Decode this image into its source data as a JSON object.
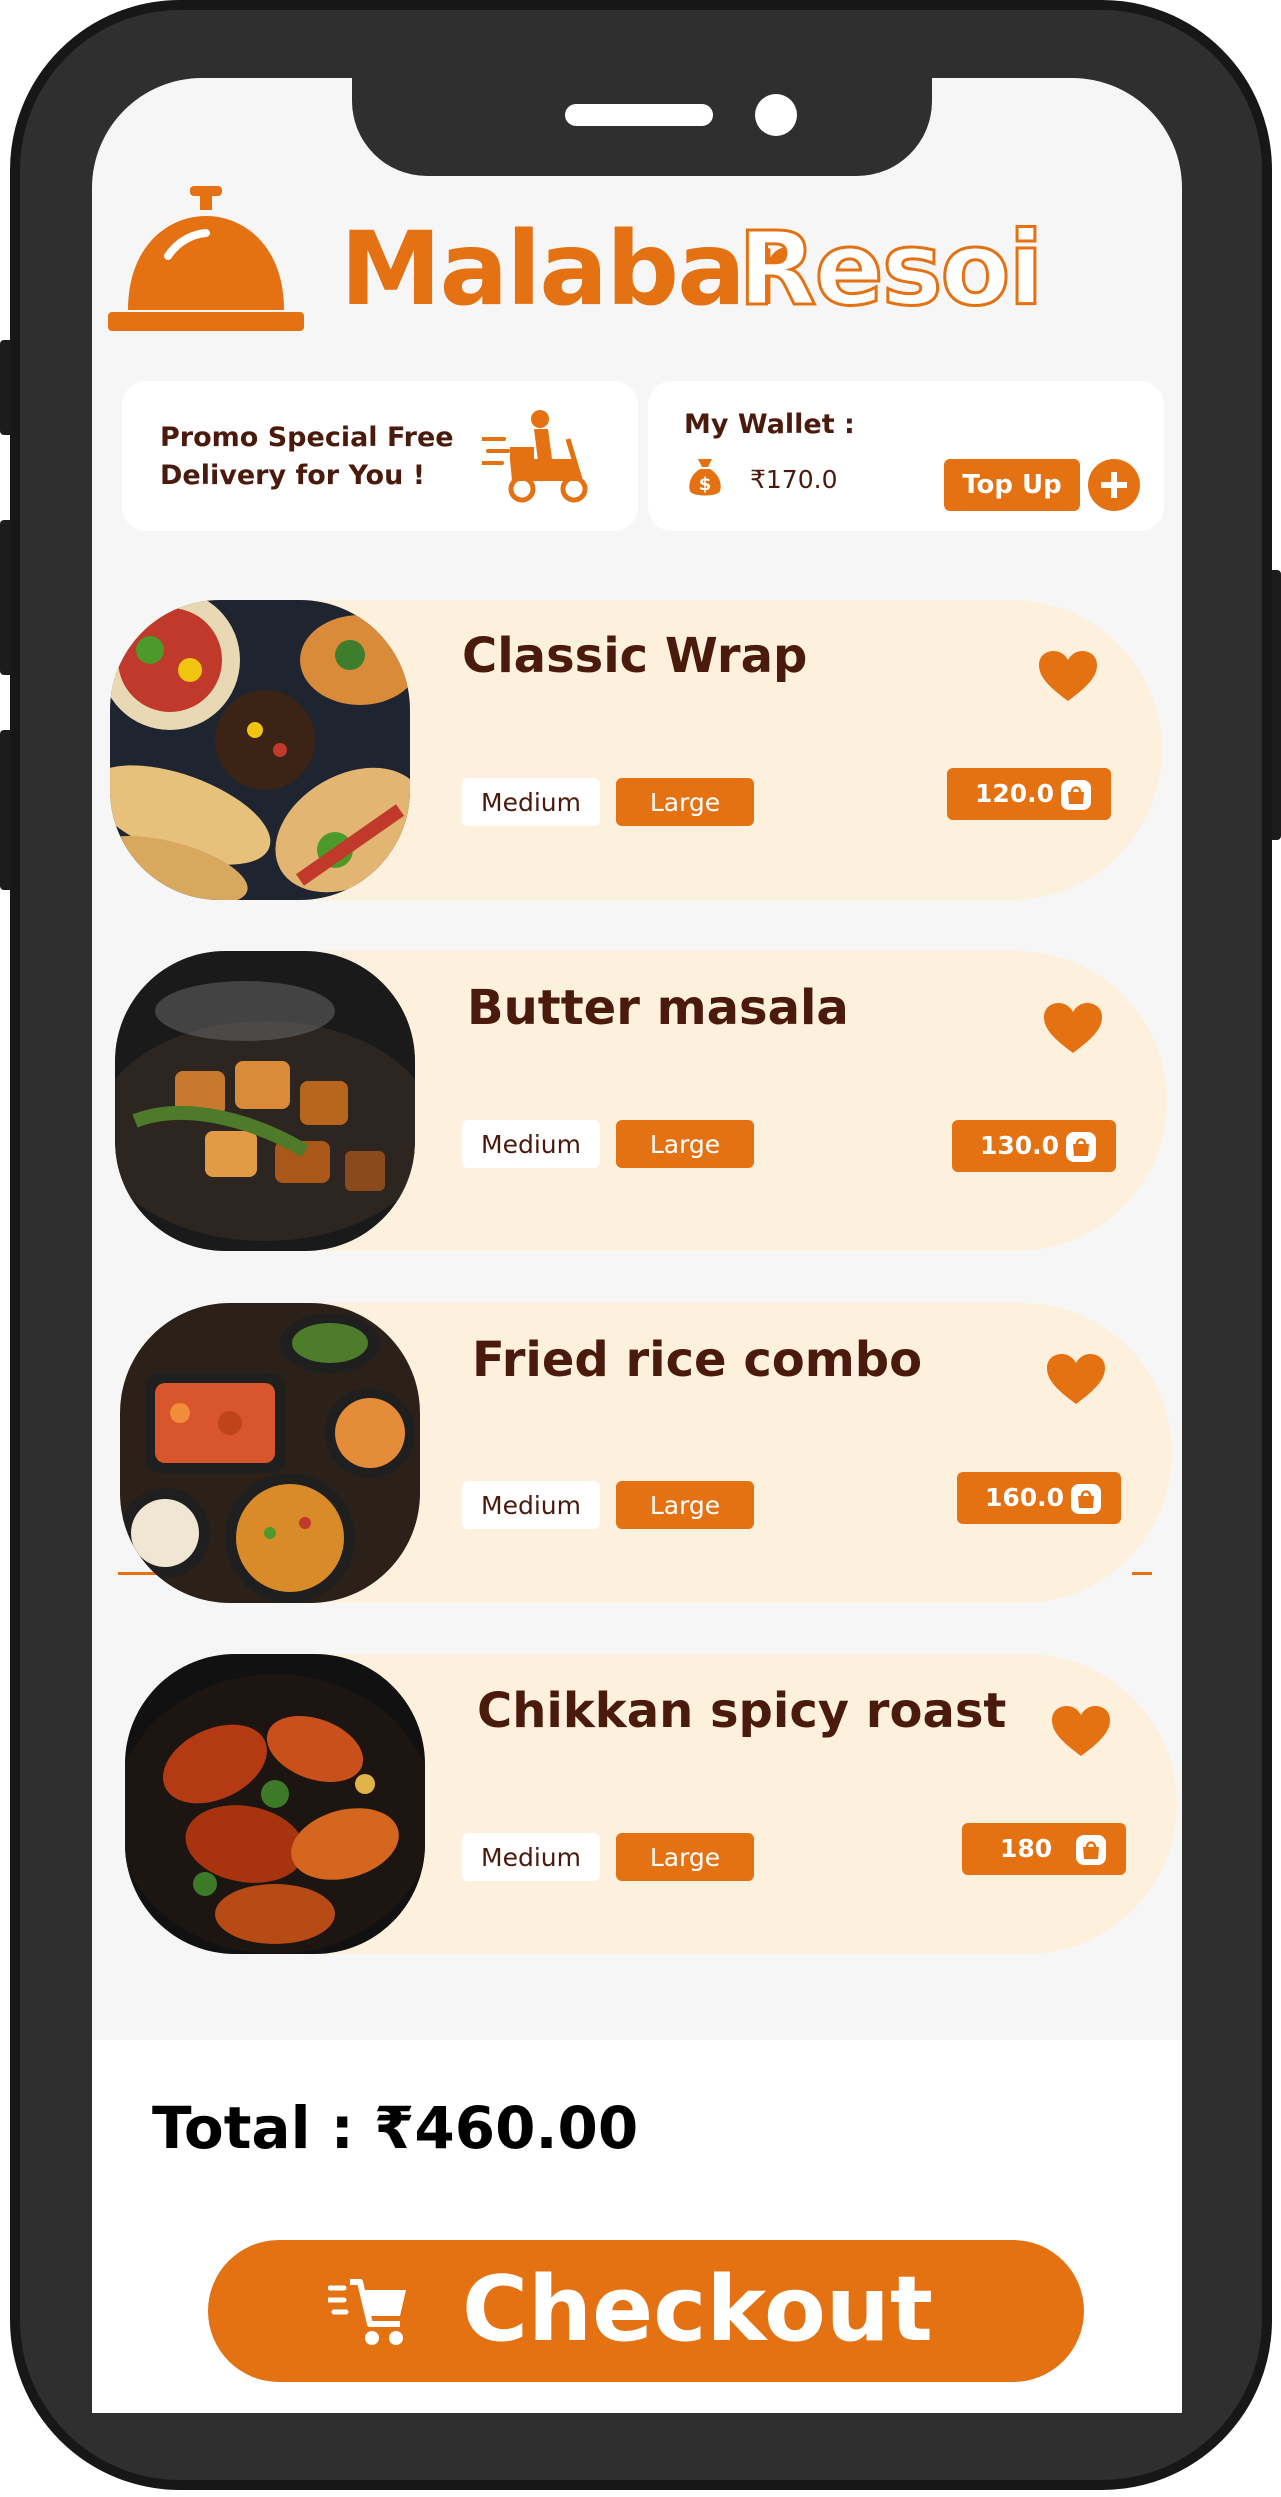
{
  "brand": {
    "name_main": "Malabar",
    "name_accent": "Resoi",
    "logo_icon": "service-bell-icon"
  },
  "promo": {
    "text": "Promo Special Free\nDelivery for You !",
    "icon": "delivery-scooter-icon"
  },
  "wallet": {
    "title": "My Wallet :",
    "amount": "₹170.0",
    "topup_label": "Top Up",
    "icon": "money-bag-icon",
    "plus_icon": "plus-circle-icon"
  },
  "items": [
    {
      "name": "Classic Wrap",
      "size_medium": "Medium",
      "size_large": "Large",
      "price": "120.0",
      "favorite": true
    },
    {
      "name": "Butter masala",
      "size_medium": "Medium",
      "size_large": "Large",
      "price": "130.0",
      "favorite": true
    },
    {
      "name": "Fried rice combo",
      "size_medium": "Medium",
      "size_large": "Large",
      "price": "160.0",
      "favorite": true
    },
    {
      "name": "Chikkan spicy roast",
      "size_medium": "Medium",
      "size_large": "Large",
      "price": "180",
      "favorite": true
    }
  ],
  "total": {
    "label": "Total : ₹460.00"
  },
  "checkout": {
    "label": "Checkout",
    "icon": "shopping-cart-icon"
  },
  "colors": {
    "accent": "#e47112",
    "text_dark": "#4a1a0c",
    "card_bg": "#fdf1de",
    "screen_bg": "#f6f6f6"
  }
}
